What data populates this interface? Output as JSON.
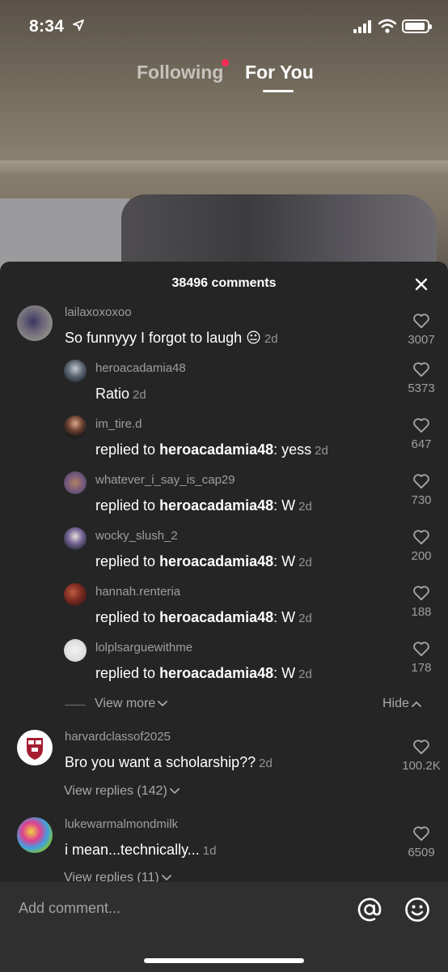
{
  "status": {
    "time": "8:34"
  },
  "tabs": {
    "following": "Following",
    "for_you": "For You"
  },
  "sheet": {
    "title": "38496 comments"
  },
  "comments": [
    {
      "user": "lailaxoxoxoo",
      "text": "So funnyyy I forgot to laugh 😐",
      "time": "2d",
      "likes": "3007"
    },
    {
      "user": "heroacadamia48",
      "text": "Ratio",
      "time": "2d",
      "likes": "5373"
    },
    {
      "user": "im_tire.d",
      "prefix": "replied to ",
      "mention": "heroacadamia48",
      "text": ": yess",
      "time": "2d",
      "likes": "647"
    },
    {
      "user": "whatever_i_say_is_cap29",
      "prefix": "replied to ",
      "mention": "heroacadamia48",
      "text": ": W",
      "time": "2d",
      "likes": "730"
    },
    {
      "user": "wocky_slush_2",
      "prefix": "replied to ",
      "mention": "heroacadamia48",
      "text": ": W",
      "time": "2d",
      "likes": "200"
    },
    {
      "user": "hannah.renteria",
      "prefix": "replied to ",
      "mention": "heroacadamia48",
      "text": ": W",
      "time": "2d",
      "likes": "188"
    },
    {
      "user": "lolplsarguewithme",
      "prefix": "replied to ",
      "mention": "heroacadamia48",
      "text": ": W",
      "time": "2d",
      "likes": "178"
    },
    {
      "user": "harvardclassof2025",
      "text": "Bro you want a scholarship??",
      "time": "2d",
      "likes": "100.2K",
      "view_replies": "View replies (142)"
    },
    {
      "user": "lukewarmalmondmilk",
      "text": "i mean...technically...",
      "time": "1d",
      "likes": "6509",
      "view_replies": "View replies (11)"
    }
  ],
  "thread": {
    "view_more": "View more",
    "hide": "Hide"
  },
  "input": {
    "placeholder": "Add comment..."
  },
  "colors": {
    "accent_dot": "#fe2c55",
    "sheet_bg": "#252525",
    "input_bg": "#2f2f2f"
  }
}
